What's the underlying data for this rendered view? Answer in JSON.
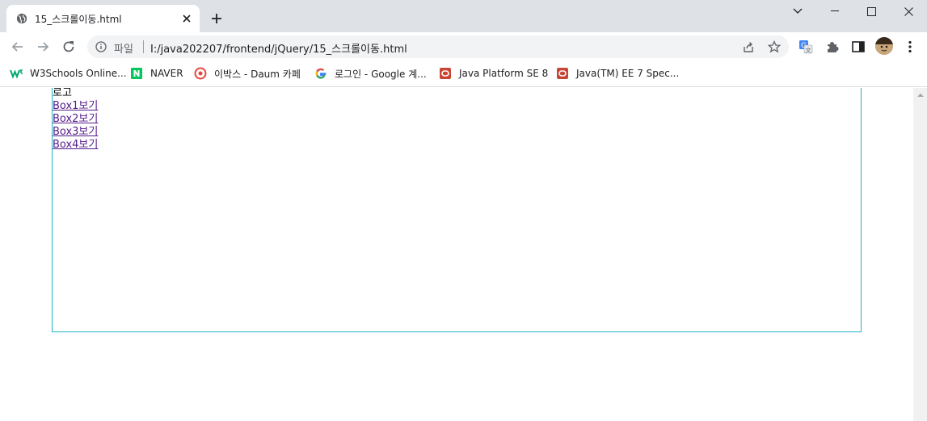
{
  "tab": {
    "title": "15_스크롤이동.html",
    "favicon": "globe-icon"
  },
  "toolbar": {
    "scheme_label": "파일",
    "url": "I:/java202207/frontend/jQuery/15_스크롤이동.html"
  },
  "bookmarks": [
    {
      "label": "W3Schools Online...",
      "icon": "w3schools-icon",
      "color": "#04aa6d"
    },
    {
      "label": "NAVER",
      "icon": "naver-icon",
      "color": "#03c75a"
    },
    {
      "label": "이박스 - Daum 카페",
      "icon": "daum-cafe-icon",
      "color": "#e8453c"
    },
    {
      "label": "로그인 - Google 계...",
      "icon": "google-icon",
      "color": "#4285f4"
    },
    {
      "label": "Java Platform SE 8",
      "icon": "oracle-icon",
      "color": "#c74634"
    },
    {
      "label": "Java(TM) EE 7 Spec...",
      "icon": "oracle-icon",
      "color": "#c74634"
    }
  ],
  "page": {
    "logo": "로고",
    "links": [
      "Box1보기",
      "Box2보기",
      "Box3보기",
      "Box4보기"
    ],
    "box_border_color": "#20b2c8",
    "visited_link_color": "#551a8b"
  }
}
